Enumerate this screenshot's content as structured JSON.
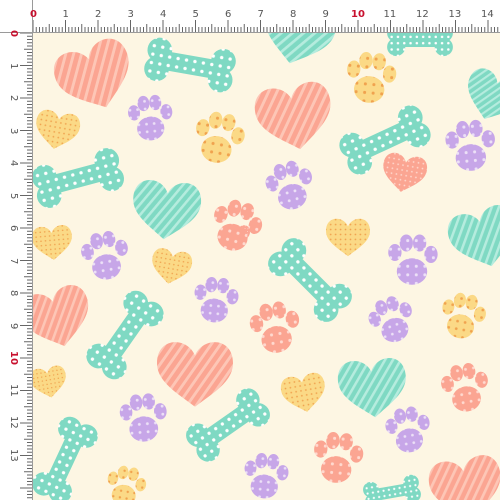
{
  "ruler": {
    "top_labels": [
      "0",
      "1",
      "2",
      "3",
      "4",
      "5",
      "6",
      "7",
      "8",
      "9",
      "10",
      "11",
      "12",
      "13",
      "14"
    ],
    "left_labels": [
      "0",
      "1",
      "2",
      "3",
      "4",
      "5",
      "6",
      "7",
      "8",
      "9",
      "10",
      "11",
      "12",
      "13"
    ],
    "accent_labels": [
      "0",
      "10"
    ]
  },
  "pattern": {
    "background": "#fdf6e3",
    "colors": {
      "mint": "#7fd9c3",
      "coral": "#fba592",
      "lavender": "#c7a6e8",
      "yellow": "#fbd986",
      "dots": "#ffffff"
    },
    "motifs": [
      "dog-bone",
      "paw-print",
      "heart"
    ],
    "textures": [
      "polka-dots",
      "diagonal-stripes"
    ]
  }
}
